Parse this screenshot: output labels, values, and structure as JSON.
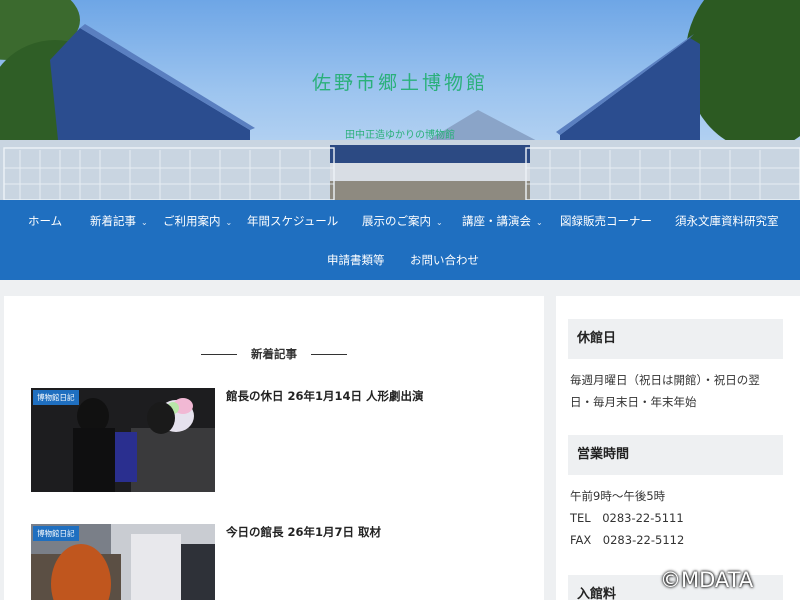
{
  "site": {
    "title": "佐野市郷土博物館",
    "tagline": "田中正造ゆかりの博物館"
  },
  "nav": {
    "items": [
      {
        "label": "ホーム",
        "has_submenu": false
      },
      {
        "label": "新着記事",
        "has_submenu": true
      },
      {
        "label": "ご利用案内",
        "has_submenu": true
      },
      {
        "label": "年間スケジュール",
        "has_submenu": false
      },
      {
        "label": "展示のご案内",
        "has_submenu": true
      },
      {
        "label": "講座・講演会",
        "has_submenu": true
      },
      {
        "label": "図録販売コーナー",
        "has_submenu": false
      },
      {
        "label": "須永文庫資料研究室",
        "has_submenu": false
      },
      {
        "label": "申請書類等",
        "has_submenu": false
      },
      {
        "label": "お問い合わせ",
        "has_submenu": false
      }
    ]
  },
  "main": {
    "section_heading": "新着記事",
    "posts": [
      {
        "category": "博物館日記",
        "title": "館長の休日 26年1月14日 人形劇出演"
      },
      {
        "category": "博物館日記",
        "title": "今日の館長 26年1月7日 取材"
      }
    ]
  },
  "sidebar": {
    "widgets": [
      {
        "title": "休館日",
        "lines": [
          "毎週月曜日（祝日は開館）・祝日の翌",
          "日・毎月末日・年末年始"
        ]
      },
      {
        "title": "営業時間",
        "lines": [
          "午前9時～午後5時",
          "TEL　0283-22-5111",
          "FAX　0283-22-5112"
        ]
      },
      {
        "title": "入館料",
        "lines": []
      }
    ]
  },
  "watermark": "©MDATA",
  "colors": {
    "nav_bg": "#1f6fc0",
    "title_green": "#2ab07a",
    "badge_bg": "#1f6fc0"
  }
}
